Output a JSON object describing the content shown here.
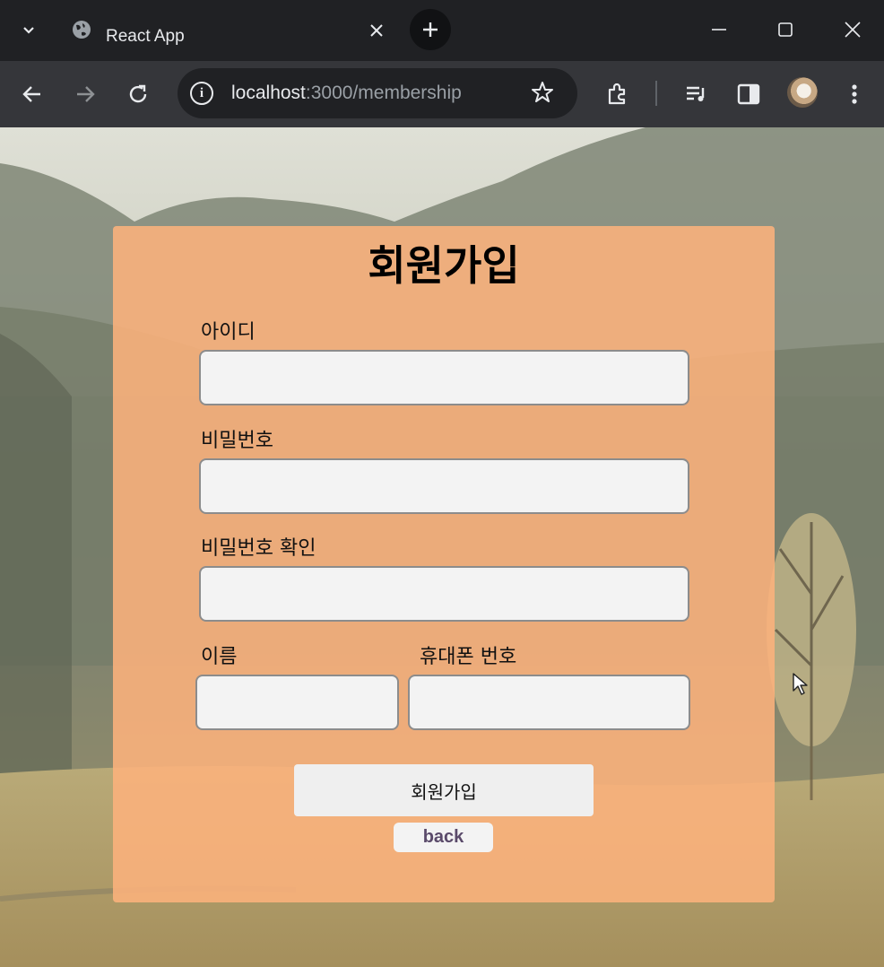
{
  "browser": {
    "tab_title": "React App",
    "url_host": "localhost",
    "url_path": ":3000/membership"
  },
  "form": {
    "title": "회원가입",
    "fields": {
      "id": {
        "label": "아이디",
        "value": ""
      },
      "password": {
        "label": "비밀번호",
        "value": ""
      },
      "password_confirm": {
        "label": "비밀번호 확인",
        "value": ""
      },
      "name": {
        "label": "이름",
        "value": ""
      },
      "phone": {
        "label": "휴대폰 번호",
        "value": ""
      }
    },
    "submit_label": "회원가입",
    "back_label": "back"
  },
  "colors": {
    "card": "#fcb27c",
    "input_bg": "#f3f3f3",
    "chrome_dark": "#202124",
    "chrome_toolbar": "#35363a"
  },
  "icons": [
    "tab-search-icon",
    "globe-icon",
    "close-icon",
    "plus-icon",
    "minimize-icon",
    "maximize-icon",
    "back-arrow-icon",
    "forward-arrow-icon",
    "reload-icon",
    "info-icon",
    "star-icon",
    "extensions-icon",
    "media-controls-icon",
    "side-panel-icon",
    "profile-avatar",
    "more-menu-icon"
  ]
}
